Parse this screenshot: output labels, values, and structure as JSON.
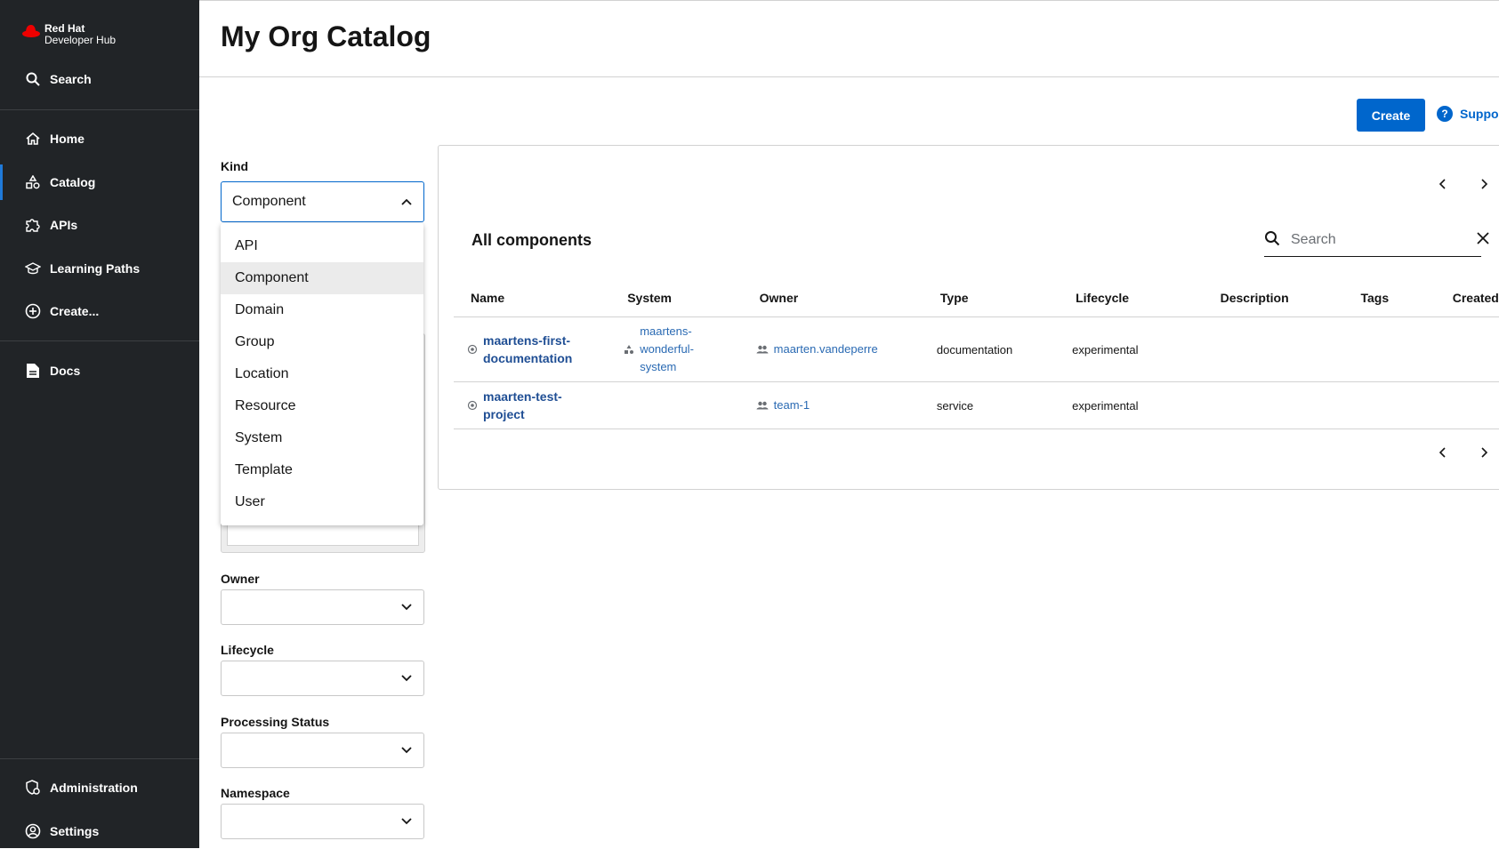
{
  "brand": {
    "line1": "Red Hat",
    "line2": "Developer Hub"
  },
  "sidebar": {
    "search": "Search",
    "items": [
      {
        "label": "Home"
      },
      {
        "label": "Catalog"
      },
      {
        "label": "APIs"
      },
      {
        "label": "Learning Paths"
      },
      {
        "label": "Create..."
      },
      {
        "label": "Docs"
      }
    ],
    "bottom": [
      {
        "label": "Administration"
      },
      {
        "label": "Settings"
      }
    ]
  },
  "header": {
    "title": "My Org Catalog"
  },
  "actions": {
    "create": "Create",
    "support": "Suppo"
  },
  "filters": {
    "kind": {
      "label": "Kind",
      "value": "Component"
    },
    "kind_options": [
      "API",
      "Component",
      "Domain",
      "Group",
      "Location",
      "Resource",
      "System",
      "Template",
      "User"
    ],
    "owner": {
      "label": "Owner",
      "value": ""
    },
    "lifecycle": {
      "label": "Lifecycle",
      "value": ""
    },
    "processing_status": {
      "label": "Processing Status",
      "value": ""
    },
    "namespace": {
      "label": "Namespace",
      "value": ""
    }
  },
  "table": {
    "title": "All components",
    "search_placeholder": "Search",
    "columns": [
      "Name",
      "System",
      "Owner",
      "Type",
      "Lifecycle",
      "Description",
      "Tags",
      "Created At"
    ],
    "rows": [
      {
        "name": "maartens-first-documentation",
        "system": "maartens-wonderful-system",
        "owner": "maarten.vandeperre",
        "type": "documentation",
        "lifecycle": "experimental"
      },
      {
        "name": "maarten-test-project",
        "system": "",
        "owner": "team-1",
        "type": "service",
        "lifecycle": "experimental"
      }
    ]
  },
  "colors": {
    "sidebar_bg": "#212427",
    "primary": "#0066cc",
    "link": "#1f4e94",
    "brand_red": "#ee0000"
  }
}
